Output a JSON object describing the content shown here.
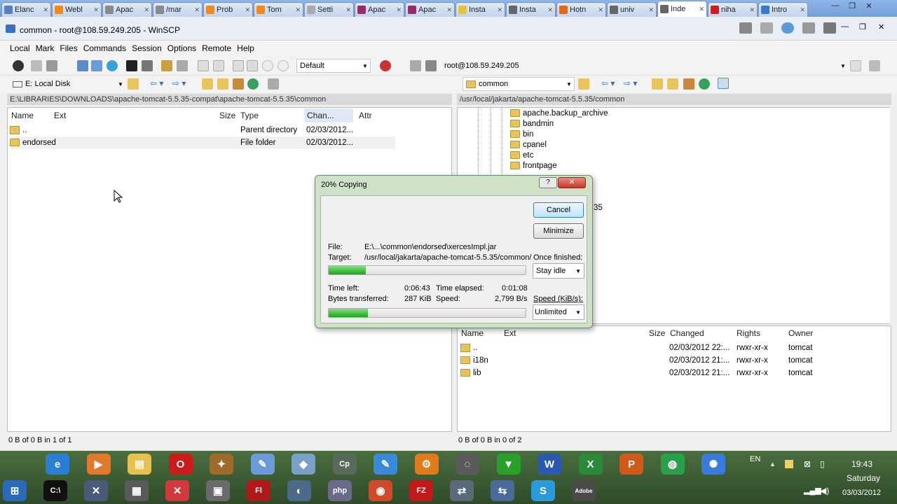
{
  "browser_tabs": [
    {
      "label": "Elanc",
      "color": "#5b7fb8"
    },
    {
      "label": "Webl",
      "color": "#f08a1a"
    },
    {
      "label": "Apac",
      "color": "#8a8a8a"
    },
    {
      "label": "/mar",
      "color": "#8a8a8a"
    },
    {
      "label": "Prob",
      "color": "#f08a1a"
    },
    {
      "label": "Tom",
      "color": "#f08a1a"
    },
    {
      "label": "Setti",
      "color": "#aaaaaa"
    },
    {
      "label": "Apac",
      "color": "#9b2a6b"
    },
    {
      "label": "Apac",
      "color": "#9b2a6b"
    },
    {
      "label": "Insta",
      "color": "#e8c23a"
    },
    {
      "label": "Insta",
      "color": "#666666"
    },
    {
      "label": "Hotn",
      "color": "#e06a1a"
    },
    {
      "label": "univ",
      "color": "#666666"
    },
    {
      "label": "Inde",
      "color": "#666666",
      "active": true
    },
    {
      "label": "niha",
      "color": "#cc2020"
    },
    {
      "label": "Intro",
      "color": "#3a7ac8"
    }
  ],
  "window": {
    "title": "common - root@108.59.249.205 - WinSCP"
  },
  "menu": [
    "Local",
    "Mark",
    "Files",
    "Commands",
    "Session",
    "Options",
    "Remote",
    "Help"
  ],
  "toolbar": {
    "profile": "Default",
    "session": "root@108.59.249.205"
  },
  "local": {
    "drive": "E: Local Disk",
    "path": "E:\\LIBRARIES\\DOWNLOADS\\apache-tomcat-5.5.35-compat\\apache-tomcat-5.5.35\\common",
    "columns": {
      "name": "Name",
      "ext": "Ext",
      "size": "Size",
      "type": "Type",
      "changed": "Chan...",
      "attr": "Attr"
    },
    "files": [
      {
        "name": "..",
        "type": "Parent directory",
        "changed": "02/03/2012..."
      },
      {
        "name": "endorsed",
        "type": "File folder",
        "changed": "02/03/2012..."
      }
    ],
    "status": "0 B of 0 B in 1 of 1"
  },
  "remote": {
    "dir": "common",
    "path": "/usr/local/jakarta/apache-tomcat-5.5.35/common",
    "tree": [
      "apache.backup_archive",
      "bandmin",
      "bin",
      "cpanel",
      "etc",
      "frontpage"
    ],
    "tree_partial": "35",
    "columns": {
      "name": "Name",
      "ext": "Ext",
      "size": "Size",
      "changed": "Changed",
      "rights": "Rights",
      "owner": "Owner"
    },
    "files": [
      {
        "name": "..",
        "changed": "02/03/2012 22:...",
        "rights": "rwxr-xr-x",
        "owner": "tomcat"
      },
      {
        "name": "i18n",
        "changed": "02/03/2012 21:...",
        "rights": "rwxr-xr-x",
        "owner": "tomcat"
      },
      {
        "name": "lib",
        "changed": "02/03/2012 21:...",
        "rights": "rwxr-xr-x",
        "owner": "tomcat"
      }
    ],
    "status": "0 B of 0 B in 0 of 2"
  },
  "dialog": {
    "title": "20% Copying",
    "cancel": "Cancel",
    "minimize": "Minimize",
    "file_label": "File:",
    "file_value": "E:\\...\\common\\endorsed\\xercesImpl.jar",
    "target_label": "Target:",
    "target_value": "/usr/local/jakarta/apache-tomcat-5.5.35/common/",
    "once_finished_label": "Once finished:",
    "once_finished_value": "Stay idle",
    "file_progress": 0.19,
    "time_left_label": "Time left:",
    "time_left": "0:06:43",
    "time_elapsed_label": "Time elapsed:",
    "time_elapsed": "0:01:08",
    "bytes_label": "Bytes transferred:",
    "bytes": "287 KiB",
    "speed_label": "Speed:",
    "speed": "2,799 B/s",
    "speed_limit_label": "Speed (KiB/s):",
    "speed_limit": "Unlimited",
    "total_progress": 0.2
  },
  "taskbar": {
    "lang": "EN",
    "time": "19:43",
    "day": "Saturday",
    "date": "03/03/2012",
    "apps_row1": [
      {
        "name": "ie",
        "glyph": "e",
        "color": "#2a7fd4"
      },
      {
        "name": "media",
        "glyph": "▶",
        "color": "#e07a2a"
      },
      {
        "name": "explorer",
        "glyph": "▤",
        "color": "#e8c050"
      },
      {
        "name": "opera",
        "glyph": "O",
        "color": "#cc1b1b"
      },
      {
        "name": "app5",
        "glyph": "✦",
        "color": "#a06a2a"
      },
      {
        "name": "paint",
        "glyph": "✎",
        "color": "#6a9ad8"
      },
      {
        "name": "box",
        "glyph": "◆",
        "color": "#7aa0c8"
      },
      {
        "name": "cp",
        "glyph": "Cp",
        "color": "#5a6a5a"
      },
      {
        "name": "app9",
        "glyph": "✎",
        "color": "#3a8ad8"
      },
      {
        "name": "settings",
        "glyph": "⚙",
        "color": "#e07a1a"
      },
      {
        "name": "app11",
        "glyph": "◌",
        "color": "#5a5a5a"
      },
      {
        "name": "download",
        "glyph": "▼",
        "color": "#2aa02a"
      },
      {
        "name": "word",
        "glyph": "W",
        "color": "#2a5ab0"
      },
      {
        "name": "excel",
        "glyph": "X",
        "color": "#2a8a3a"
      },
      {
        "name": "powerpoint",
        "glyph": "P",
        "color": "#d05a1a"
      },
      {
        "name": "app16",
        "glyph": "◍",
        "color": "#2aa04a"
      },
      {
        "name": "app17",
        "glyph": "✺",
        "color": "#3a7ad8"
      }
    ],
    "apps_row2": [
      {
        "name": "start",
        "glyph": "⊞",
        "color": "#2a6ab8"
      },
      {
        "name": "console",
        "glyph": "C:\\",
        "color": "#111111"
      },
      {
        "name": "app3",
        "glyph": "✕",
        "color": "#4a5a7a"
      },
      {
        "name": "app4",
        "glyph": "▦",
        "color": "#5a5a5a"
      },
      {
        "name": "app5",
        "glyph": "✕",
        "color": "#d03a3a"
      },
      {
        "name": "app6",
        "glyph": "▣",
        "color": "#6a6a6a"
      },
      {
        "name": "flash",
        "glyph": "Fl",
        "color": "#b01a1a"
      },
      {
        "name": "app8",
        "glyph": "◐",
        "color": "#4a6a8a"
      },
      {
        "name": "php",
        "glyph": "php",
        "color": "#6a6a8a"
      },
      {
        "name": "chrome",
        "glyph": "◉",
        "color": "#d04a2a"
      },
      {
        "name": "filezilla",
        "glyph": "FZ",
        "color": "#c01a1a"
      },
      {
        "name": "winscp",
        "glyph": "⇄",
        "color": "#5a6a7a"
      },
      {
        "name": "network",
        "glyph": "⇆",
        "color": "#4a6a9a"
      },
      {
        "name": "skype",
        "glyph": "S",
        "color": "#2a9ad8"
      },
      {
        "name": "adobe",
        "glyph": "Adobe",
        "color": "#4a4a4a"
      }
    ]
  }
}
